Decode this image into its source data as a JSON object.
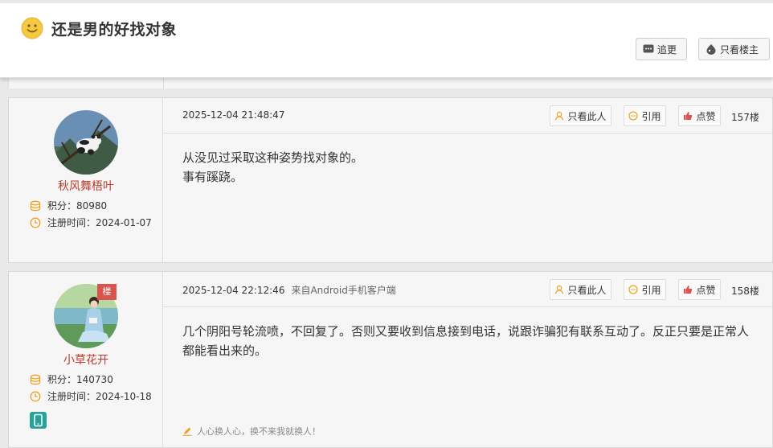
{
  "header": {
    "title": "还是男的好找对象",
    "follow_label": "追更",
    "owner_only_label": "只看楼主"
  },
  "posts": [
    {
      "username": "秋风舞梧叶",
      "points_label": "积分：",
      "points": "80980",
      "reg_label": "注册时间：",
      "reg_date": "2024-01-07",
      "time": "2025-12-04 21:48:47",
      "source": "",
      "actions": {
        "only_this": "只看此人",
        "quote": "引用",
        "like": "点赞"
      },
      "floor": "157楼",
      "body": [
        "从没见过采取这种姿势找对象的。",
        "事有蹊跷。"
      ]
    },
    {
      "username": "小草花开",
      "badge": "楼",
      "points_label": "积分：",
      "points": "140730",
      "reg_label": "注册时间：",
      "reg_date": "2024-10-18",
      "time": "2025-12-04 22:12:46",
      "source": "来自Android手机客户端",
      "actions": {
        "only_this": "只看此人",
        "quote": "引用",
        "like": "点赞"
      },
      "floor": "158楼",
      "body": [
        "几个阴阳号轮流喷，不回复了。否则又要收到信息接到电话，说跟诈骗犯有联系互动了。反正只要是正常人都能看出来的。"
      ],
      "signature": "人心换人心，换不来我就换人！"
    }
  ],
  "colors": {
    "username": "#c0392b",
    "icon_orange": "#f0a020",
    "like_red": "#e05050",
    "badge_red": "#d9534f",
    "phone_teal": "#2aa198"
  }
}
